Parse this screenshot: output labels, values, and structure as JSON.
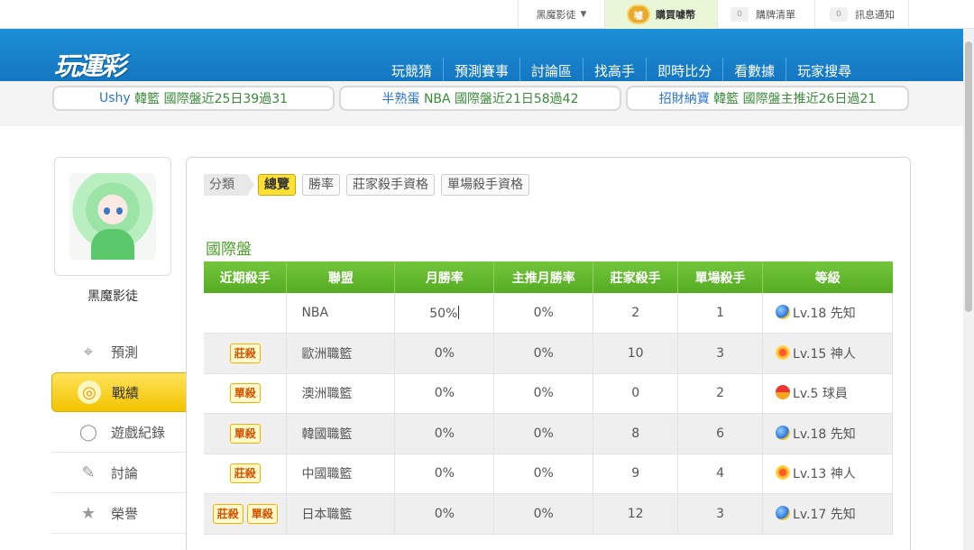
{
  "topbar": {
    "user": "黑魔影徒",
    "buy_label": "購買噱幣",
    "coin_glyph": "噱",
    "cart_count": "0",
    "cart_label": "購牌清單",
    "msg_count": "0",
    "msg_label": "訊息通知"
  },
  "header": {
    "logo": "玩運彩",
    "nav": [
      "玩競猜",
      "預測賽事",
      "討論區",
      "找高手",
      "即時比分",
      "看數據",
      "玩家搜尋"
    ]
  },
  "promos": [
    {
      "user": "Ushy",
      "text": "韓籃 國際盤近25日39過31"
    },
    {
      "user": "半熟蛋",
      "text": "NBA 國際盤近21日58過42"
    },
    {
      "user": "招財納寶",
      "text": "韓籃 國際盤主推近26日過21"
    }
  ],
  "sidebar": {
    "username": "黑魔影徒",
    "items": [
      "預測",
      "戰績",
      "遊戲紀錄",
      "討論",
      "榮譽"
    ]
  },
  "filter": {
    "label": "分類",
    "buttons": [
      "總覽",
      "勝率",
      "莊家殺手資格",
      "單場殺手資格"
    ]
  },
  "section_title": "國際盤",
  "table": {
    "headers": [
      "近期殺手",
      "聯盟",
      "月勝率",
      "主推月勝率",
      "莊家殺手",
      "單場殺手",
      "等級"
    ],
    "rows": [
      {
        "badges": [],
        "league": "NBA",
        "win": "50%",
        "main_win": "0%",
        "zhuang": "2",
        "dan": "1",
        "level": "Lv.18 先知",
        "level_icon": "xianzhi"
      },
      {
        "badges": [
          "莊殺"
        ],
        "league": "歐洲職籃",
        "win": "0%",
        "main_win": "0%",
        "zhuang": "10",
        "dan": "3",
        "level": "Lv.15 神人",
        "level_icon": "shenren"
      },
      {
        "badges": [
          "單殺"
        ],
        "league": "澳洲職籃",
        "win": "0%",
        "main_win": "0%",
        "zhuang": "0",
        "dan": "2",
        "level": "Lv.5 球員",
        "level_icon": "qiuyuan"
      },
      {
        "badges": [
          "單殺"
        ],
        "league": "韓國職籃",
        "win": "0%",
        "main_win": "0%",
        "zhuang": "8",
        "dan": "6",
        "level": "Lv.18 先知",
        "level_icon": "xianzhi"
      },
      {
        "badges": [
          "莊殺"
        ],
        "league": "中國職籃",
        "win": "0%",
        "main_win": "0%",
        "zhuang": "9",
        "dan": "4",
        "level": "Lv.13 神人",
        "level_icon": "shenren"
      },
      {
        "badges": [
          "莊殺",
          "單殺"
        ],
        "league": "日本職籃",
        "win": "0%",
        "main_win": "0%",
        "zhuang": "12",
        "dan": "3",
        "level": "Lv.17 先知",
        "level_icon": "xianzhi"
      }
    ]
  },
  "colors": {
    "header_blue": "#1680c8",
    "table_green": "#5fb52a",
    "active_yellow": "#ffe033",
    "badge_orange": "#d35400"
  }
}
